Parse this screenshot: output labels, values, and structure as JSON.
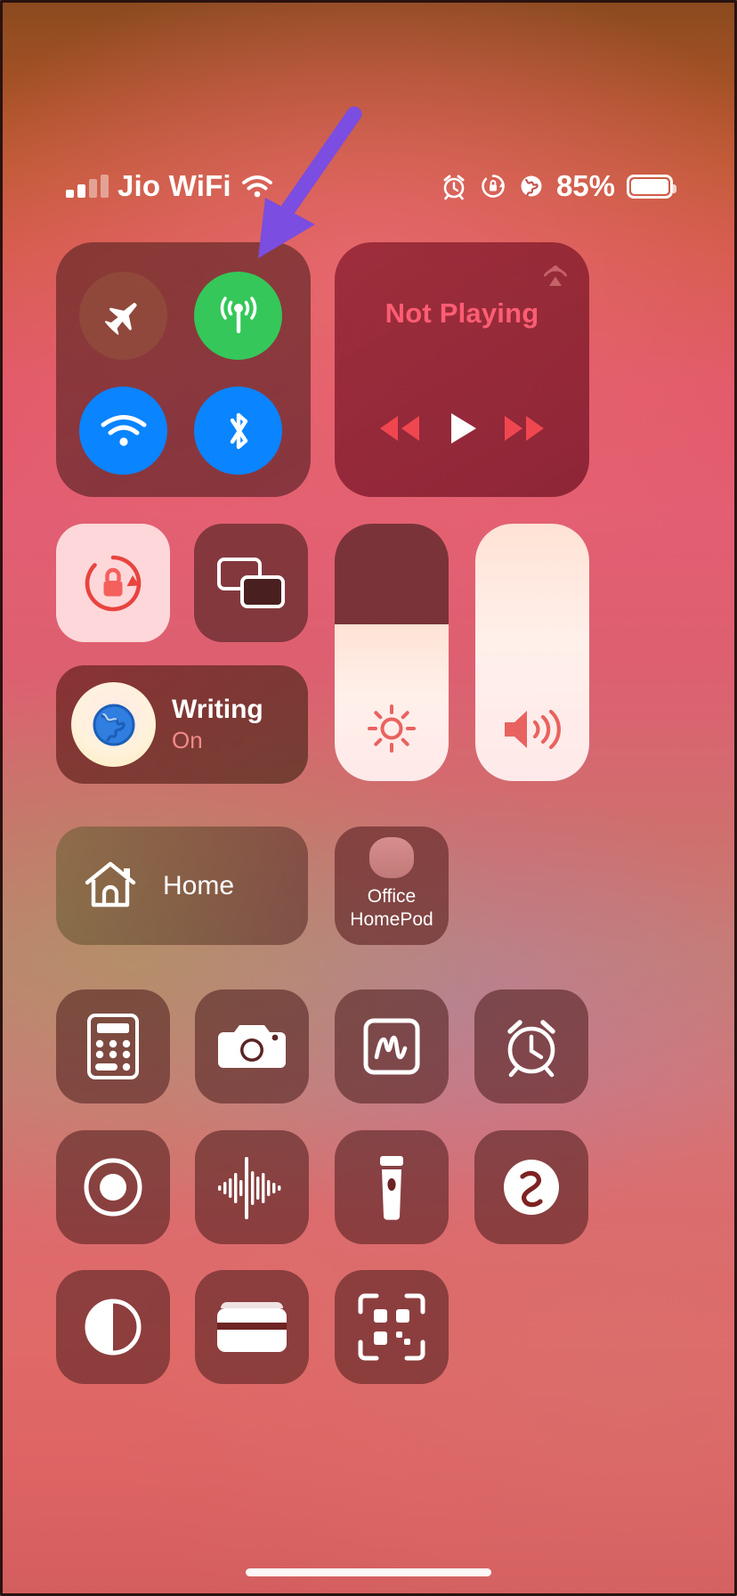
{
  "status_bar": {
    "carrier": "Jio WiFi",
    "signal_icon": "cellular-signal-icon",
    "wifi_icon": "wifi-icon",
    "alarm_icon": "alarm-clock-icon",
    "rotation_lock_icon": "rotation-lock-icon",
    "location_icon": "globe-location-icon",
    "battery_percent": "85%",
    "battery_icon": "battery-full-icon"
  },
  "connectivity": {
    "module_name": "Connectivity",
    "toggles": [
      {
        "name": "Airplane Mode",
        "icon": "airplane-icon",
        "state": "Off",
        "color": "#96563e"
      },
      {
        "name": "Cellular Data",
        "icon": "cellular-antenna-icon",
        "state": "On",
        "color": "#35c759"
      },
      {
        "name": "Wi-Fi",
        "icon": "wifi-icon",
        "state": "On",
        "color": "#0a84ff"
      },
      {
        "name": "Bluetooth",
        "icon": "bluetooth-icon",
        "state": "On",
        "color": "#0a84ff"
      }
    ]
  },
  "media": {
    "now_playing_text": "Not Playing",
    "title_color": "#ff5d73",
    "airplay_icon": "airplay-audio-icon",
    "controls": [
      {
        "name": "Rewind",
        "icon": "rewind-icon"
      },
      {
        "name": "Play",
        "icon": "play-icon"
      },
      {
        "name": "Fast Forward",
        "icon": "fast-forward-icon"
      }
    ]
  },
  "toggles": {
    "rotation_lock": {
      "name": "Rotation Lock",
      "icon": "rotation-lock-icon",
      "state": "On",
      "accent": "#e8433f"
    },
    "screen_mirroring": {
      "name": "Screen Mirroring",
      "icon": "screen-mirroring-icon",
      "state": "Off"
    }
  },
  "focus": {
    "title": "Writing",
    "subtitle": "On",
    "icon": "globe-emoji-icon"
  },
  "sliders": {
    "brightness": {
      "name": "Brightness",
      "icon": "brightness-sun-icon",
      "level_percent": 61
    },
    "volume": {
      "name": "Volume",
      "icon": "speaker-wave-icon",
      "level_percent": 100
    }
  },
  "home": {
    "label": "Home",
    "icon": "home-house-icon"
  },
  "homepod": {
    "label_line1": "Office",
    "label_line2": "HomePod",
    "icon": "homepod-speaker-icon"
  },
  "apps": [
    {
      "name": "Calculator",
      "icon": "calculator-icon"
    },
    {
      "name": "Camera",
      "icon": "camera-icon"
    },
    {
      "name": "Quick Note",
      "icon": "quick-note-icon"
    },
    {
      "name": "Alarm",
      "icon": "alarm-clock-icon"
    },
    {
      "name": "Screen Recording",
      "icon": "screen-record-icon"
    },
    {
      "name": "Sound Recognition",
      "icon": "sound-recognition-icon"
    },
    {
      "name": "Flashlight",
      "icon": "flashlight-icon"
    },
    {
      "name": "Shazam",
      "icon": "shazam-icon"
    },
    {
      "name": "Dark Mode",
      "icon": "dark-mode-icon"
    },
    {
      "name": "Wallet",
      "icon": "wallet-icon"
    },
    {
      "name": "Code Scanner",
      "icon": "qr-code-scanner-icon"
    }
  ],
  "annotation": {
    "arrow_color": "#7b4de0",
    "points_at": "Cellular Data toggle"
  },
  "home_indicator": {
    "name": "Home Indicator"
  }
}
